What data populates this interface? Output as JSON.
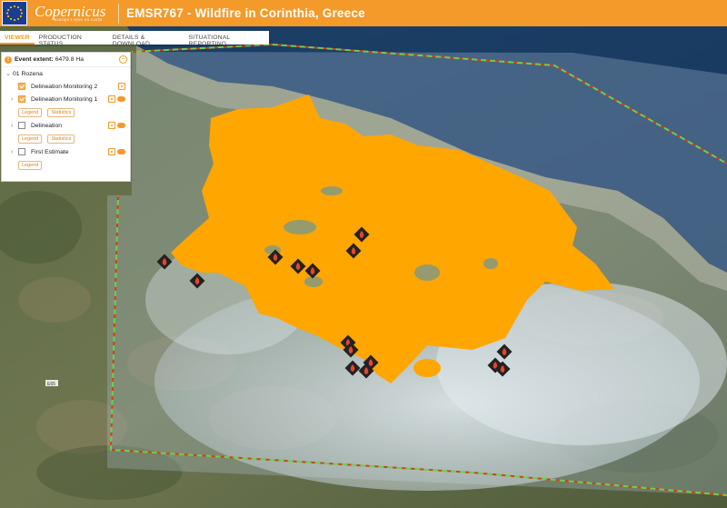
{
  "header": {
    "title": "EMSR767 - Wildfire in Corinthia, Greece",
    "logo_text": "Copernicus",
    "logo_subtext": "Europe's eyes on Earth",
    "flag_icon": "eu-flag-icon",
    "accent_color": "#f39a2a"
  },
  "tabs": [
    {
      "label": "Viewer"
    },
    {
      "label": "Production Status"
    },
    {
      "label": "Details & Download"
    },
    {
      "label": "Situational Reporting"
    }
  ],
  "panel": {
    "extent_label": "Event extent:",
    "extent_value": "6479.8 Ha",
    "group_name": "01 Rozena",
    "layers": [
      {
        "label": "Delineation Monitoring 2",
        "checked": true,
        "buttons": []
      },
      {
        "label": "Delineation Monitoring 1",
        "checked": true,
        "buttons": [
          "Legend",
          "Statistics"
        ]
      },
      {
        "label": "Delineation",
        "checked": false,
        "buttons": [
          "Legend",
          "Statistics"
        ]
      },
      {
        "label": "First Estimate",
        "checked": false,
        "buttons": [
          "Legend"
        ]
      }
    ]
  },
  "map": {
    "burnt_area_color": "#ffa600",
    "road_labels": [
      "E65",
      "E65"
    ]
  }
}
